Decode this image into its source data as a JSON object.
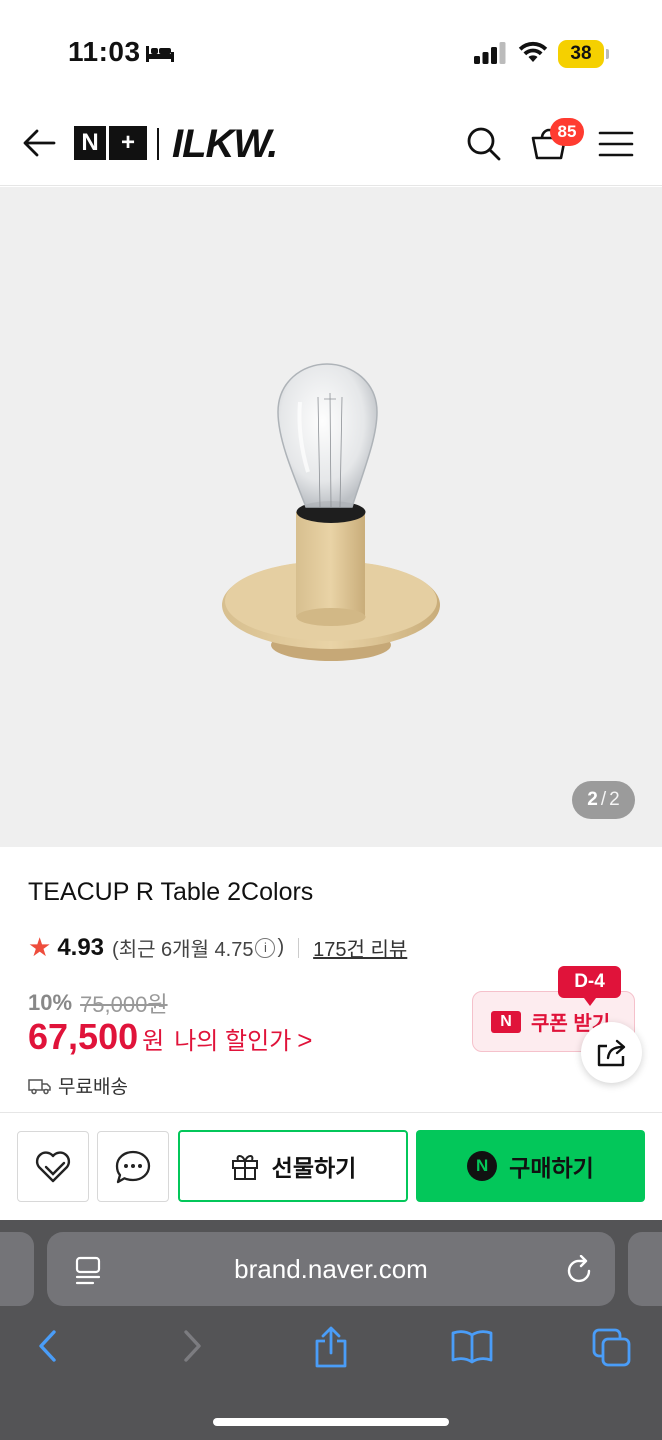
{
  "status_bar": {
    "time": "11:03",
    "battery": "38"
  },
  "header": {
    "logo_badge": [
      "N",
      "+"
    ],
    "brand": "ILKW.",
    "cart_count": "85"
  },
  "gallery": {
    "current": "2",
    "separator": "/",
    "total": "2"
  },
  "product": {
    "title": "TEACUP R Table 2Colors",
    "rating": "4.93",
    "recent_prefix": "(최근 6개월 4.75",
    "recent_info_icon": "i",
    "recent_suffix": ")",
    "reviews": "175건 리뷰",
    "discount_pct": "10%",
    "original_price": "75,000원",
    "price": "67,500",
    "price_unit": "원",
    "my_price_label": "나의 할인가",
    "my_price_chevron": ">",
    "shipping": "무료배송"
  },
  "coupon": {
    "tag": "D-4",
    "logo": "N",
    "label": "쿠폰 받기"
  },
  "actions": {
    "gift_label": "선물하기",
    "buy_logo": "N",
    "buy_label": "구매하기"
  },
  "browser": {
    "url": "brand.naver.com"
  },
  "colors": {
    "naver_green": "#03c75a",
    "price_red": "#e0133a",
    "badge_red": "#ff3b30",
    "battery_yellow": "#f5d000"
  }
}
